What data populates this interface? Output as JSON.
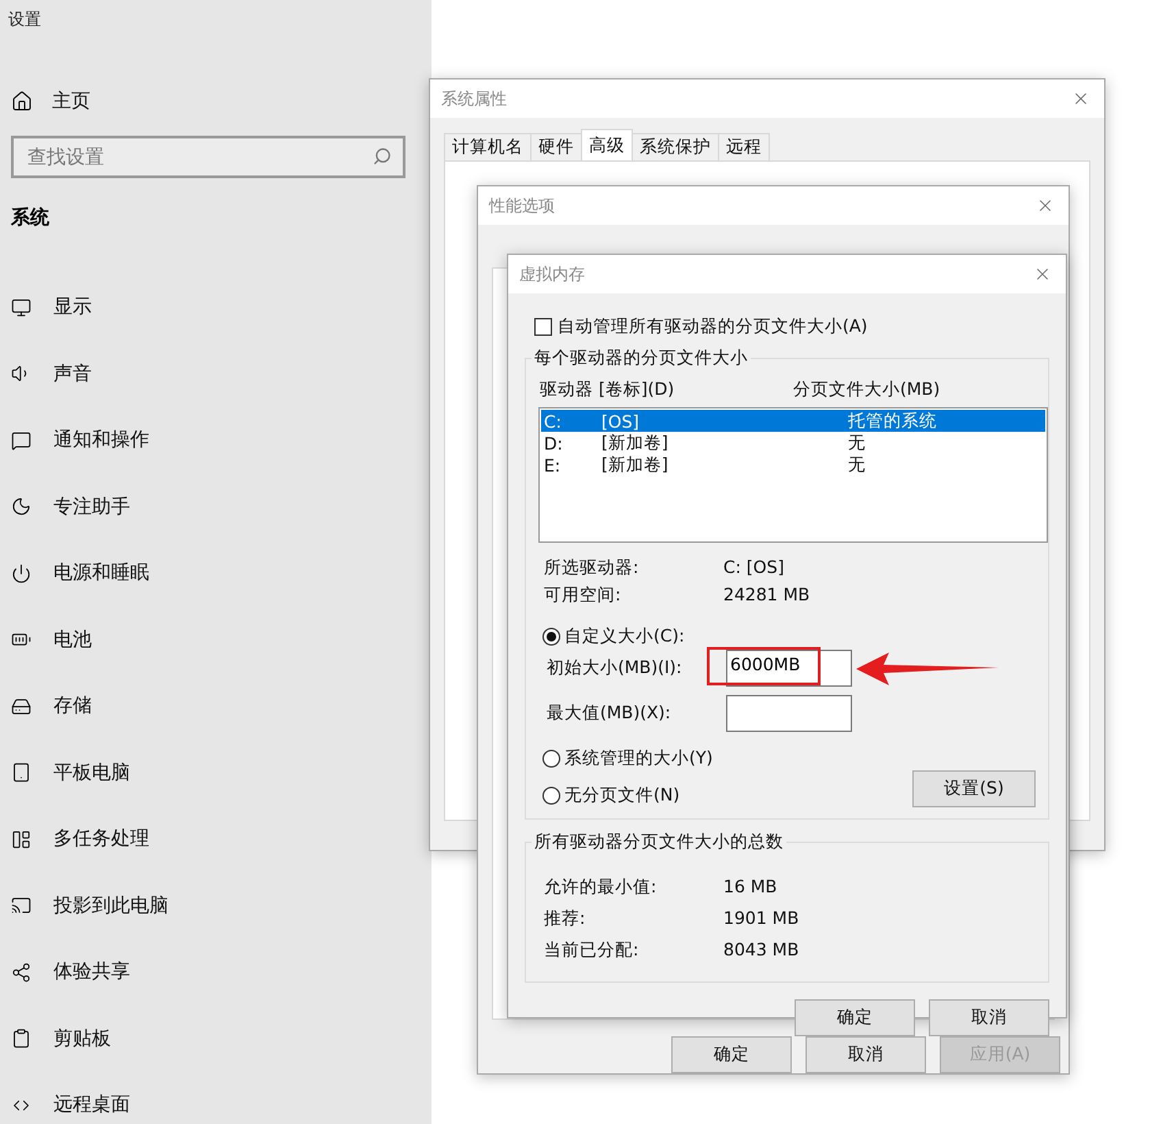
{
  "settings": {
    "title": "设置",
    "home": "主页",
    "search": {
      "placeholder": "查找设置"
    },
    "section": "系统",
    "items": [
      {
        "label": "显示"
      },
      {
        "label": "声音"
      },
      {
        "label": "通知和操作"
      },
      {
        "label": "专注助手"
      },
      {
        "label": "电源和睡眠"
      },
      {
        "label": "电池"
      },
      {
        "label": "存储"
      },
      {
        "label": "平板电脑"
      },
      {
        "label": "多任务处理"
      },
      {
        "label": "投影到此电脑"
      },
      {
        "label": "体验共享"
      },
      {
        "label": "剪贴板"
      },
      {
        "label": "远程桌面"
      }
    ]
  },
  "system_properties": {
    "title": "系统属性",
    "tabs": [
      {
        "label": "计算机名",
        "selected": false
      },
      {
        "label": "硬件",
        "selected": false
      },
      {
        "label": "高级",
        "selected": true
      },
      {
        "label": "系统保护",
        "selected": false
      },
      {
        "label": "远程",
        "selected": false
      }
    ]
  },
  "performance_options": {
    "title": "性能选项",
    "buttons": [
      {
        "label": "确定",
        "disabled": false
      },
      {
        "label": "取消",
        "disabled": false
      },
      {
        "label": "应用(A)",
        "disabled": true
      }
    ]
  },
  "virtual_memory": {
    "title": "虚拟内存",
    "auto_manage": {
      "label": "自动管理所有驱动器的分页文件大小(A)",
      "checked": false
    },
    "drives_group": {
      "title": "每个驱动器的分页文件大小",
      "columns": [
        "驱动器 [卷标](D)",
        "分页文件大小(MB)"
      ],
      "rows": [
        {
          "drive": "C:",
          "volume": "[OS]",
          "size": "托管的系统",
          "selected": true
        },
        {
          "drive": "D:",
          "volume": "[新加卷]",
          "size": "无",
          "selected": false
        },
        {
          "drive": "E:",
          "volume": "[新加卷]",
          "size": "无",
          "selected": false
        }
      ],
      "info": [
        {
          "label": "所选驱动器:",
          "value": "C:  [OS]"
        },
        {
          "label": "可用空间:",
          "value": "24281 MB"
        }
      ],
      "custom_size": {
        "label": "自定义大小(C):",
        "selected": true
      },
      "initial_size": {
        "label": "初始大小(MB)(I):",
        "value": "6000MB",
        "highlighted": true
      },
      "maximum_size": {
        "label": "最大值(MB)(X):"
      },
      "system_managed": {
        "label": "系统管理的大小(Y)",
        "selected": false
      },
      "no_paging": {
        "label": "无分页文件(N)",
        "selected": false
      },
      "set_button": "设置(S)"
    },
    "totals_group": {
      "title": "所有驱动器分页文件大小的总数",
      "rows": [
        {
          "label": "允许的最小值:",
          "value": "16 MB"
        },
        {
          "label": "推荐:",
          "value": "1901 MB"
        },
        {
          "label": "当前已分配:",
          "value": "8043 MB"
        }
      ]
    },
    "buttons": [
      {
        "label": "确定"
      },
      {
        "label": "取消"
      }
    ]
  }
}
